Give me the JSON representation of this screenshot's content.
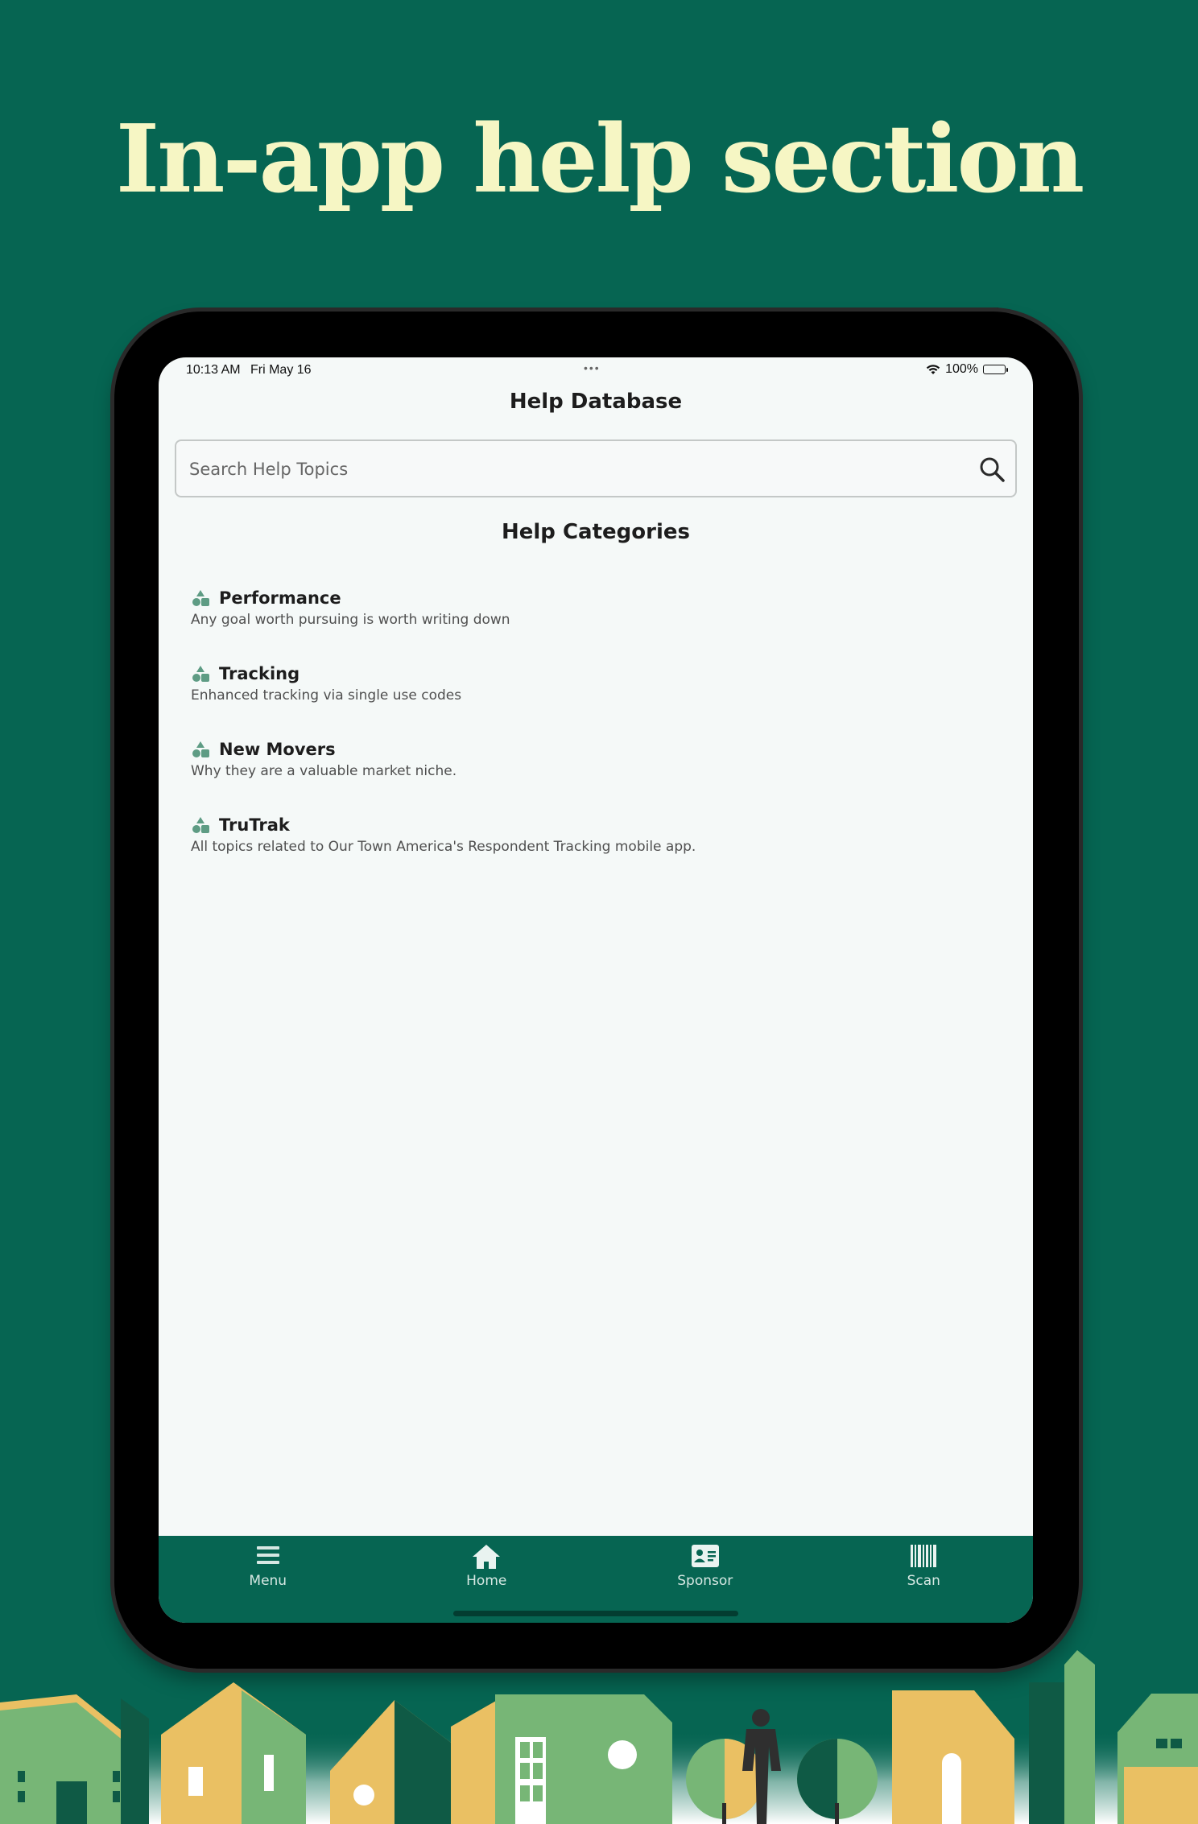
{
  "headline": "In-app help section",
  "status": {
    "time": "10:13 AM",
    "date": "Fri May 16",
    "battery": "100%"
  },
  "header": {
    "title": "Help Database"
  },
  "search": {
    "placeholder": "Search Help Topics"
  },
  "categories_heading": "Help Categories",
  "categories": [
    {
      "name": "Performance",
      "description": "Any goal worth pursuing is worth writing down",
      "icon": "shapes-icon"
    },
    {
      "name": "Tracking",
      "description": "Enhanced tracking via single use codes",
      "icon": "shapes-icon"
    },
    {
      "name": "New Movers",
      "description": "Why they are a valuable market niche.",
      "icon": "shapes-icon"
    },
    {
      "name": "TruTrak",
      "description": "All topics related to Our Town America's Respondent Tracking mobile app.",
      "icon": "shapes-icon"
    }
  ],
  "tabs": [
    {
      "label": "Menu",
      "icon": "menu-icon"
    },
    {
      "label": "Home",
      "icon": "home-icon"
    },
    {
      "label": "Sponsor",
      "icon": "id-card-icon"
    },
    {
      "label": "Scan",
      "icon": "barcode-icon"
    }
  ],
  "colors": {
    "background": "#066552",
    "headline": "#f6f6c4",
    "screen": "#f5f9f8",
    "tabbar": "#066552",
    "icon_accent": "#5e9c84"
  }
}
